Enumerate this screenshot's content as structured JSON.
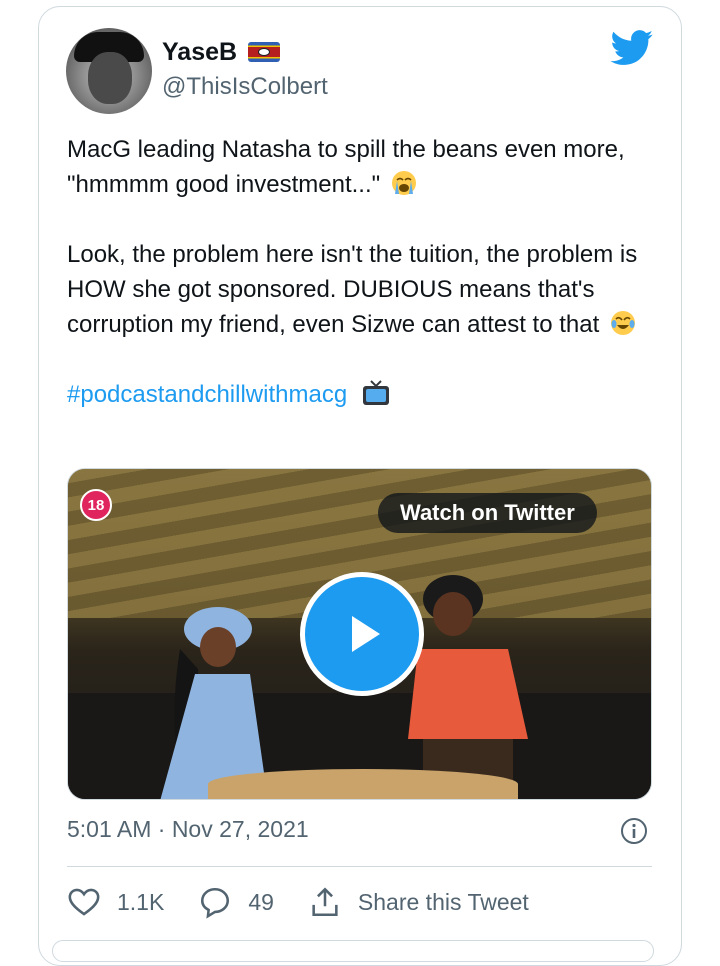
{
  "user": {
    "display_name": "YaseB",
    "handle": "@ThisIsColbert",
    "flag_icon": "eswatini-flag-icon"
  },
  "tweet": {
    "paragraph1": "MacG leading Natasha to spill the beans even more, \"hmmmm good investment...\"",
    "paragraph2": "Look, the problem here isn't the tuition, the problem is HOW she got sponsored. DUBIOUS means that's corruption my friend, even Sizwe can attest to that",
    "hashtag": "#podcastandchillwithmacg",
    "emoji1": "crying-face-icon",
    "emoji2": "tears-of-joy-icon",
    "emoji3": "television-icon"
  },
  "media": {
    "age_badge": "18",
    "watch_label": "Watch on Twitter"
  },
  "meta": {
    "timestamp": "5:01 AM · Nov 27, 2021"
  },
  "actions": {
    "likes": "1.1K",
    "replies": "49",
    "share_label": "Share this Tweet"
  },
  "colors": {
    "accent": "#1d9bf0",
    "text": "#0f1419",
    "secondary": "#536471",
    "border": "#cfd9de"
  }
}
